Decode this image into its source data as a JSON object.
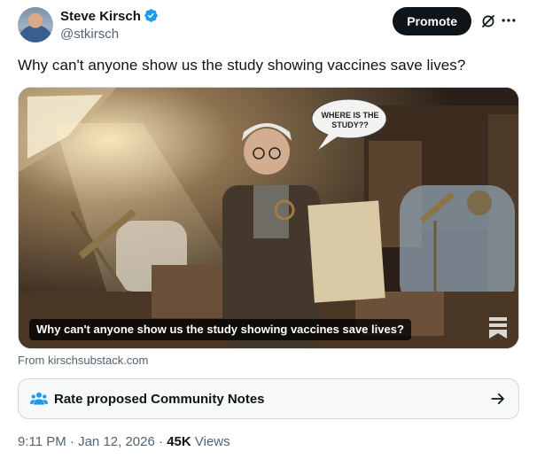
{
  "author": {
    "name": "Steve Kirsch",
    "handle": "@stkirsch"
  },
  "header": {
    "promote_label": "Promote"
  },
  "post": {
    "text": "Why can't anyone show us the study showing vaccines save lives?"
  },
  "media": {
    "speech_bubble_line1": "WHERE IS THE",
    "speech_bubble_line2": "STUDY??",
    "caption": "Why can't anyone show us the study showing vaccines save lives?",
    "source": "From kirschsubstack.com"
  },
  "community_notes": {
    "label": "Rate proposed Community Notes"
  },
  "meta": {
    "time": "9:11 PM",
    "separator": "·",
    "date": "Jan 12, 2026",
    "views_count": "45K",
    "views_label": "Views"
  },
  "colors": {
    "text_primary": "#0f1419",
    "text_secondary": "#536471",
    "verified_blue": "#1d9bf0",
    "notes_blue": "#1d9bf0",
    "border": "#cfd9de"
  }
}
